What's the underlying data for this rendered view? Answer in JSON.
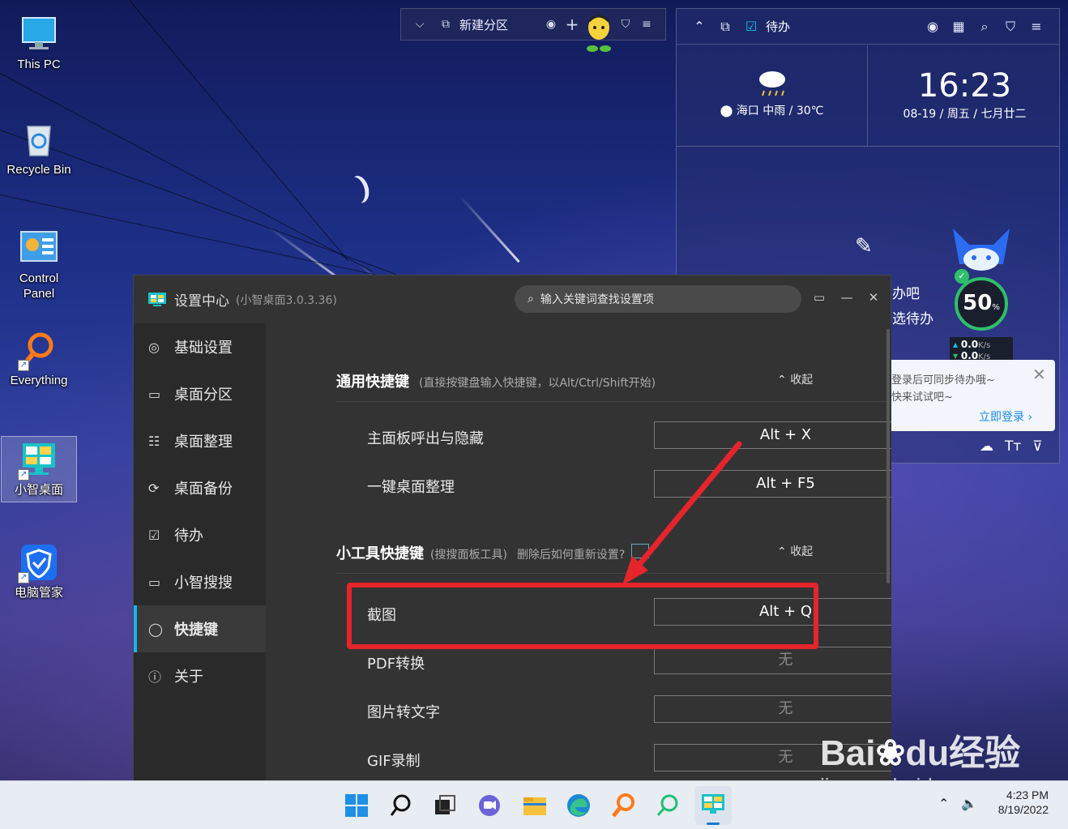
{
  "desktop": {
    "icons": [
      {
        "label": "This PC"
      },
      {
        "label": "Recycle Bin"
      },
      {
        "label": "Control Panel"
      },
      {
        "label": "Everything"
      },
      {
        "label": "小智桌面"
      },
      {
        "label": "电脑管家"
      }
    ]
  },
  "partition_bar": {
    "label": "新建分区",
    "icons": [
      "chevron-down-icon",
      "partition-icon",
      "user-icon",
      "plus-icon",
      "mascot-icon",
      "shirt-icon",
      "menu-icon"
    ]
  },
  "todo_widget": {
    "title": "待办",
    "weather": {
      "city": "海口",
      "condition": "中雨",
      "temp": "30℃",
      "icon": "rain-cloud-icon"
    },
    "clock": {
      "time": "16:23",
      "date": "08-19 / 周五 / 七月廿二"
    },
    "partial_text_1": "办吧",
    "partial_text_2": "选待办",
    "toolbar_icons": [
      "cloud-sync-icon",
      "font-size-icon",
      "filter-icon"
    ]
  },
  "speed_ball": {
    "percent": "50",
    "unit": "%",
    "upload": "0.0",
    "download": "0.0",
    "rate_unit": "K/s"
  },
  "login_popup": {
    "line1": "登录后可同步待办哦~",
    "line2": "快来试试吧~",
    "link": "立即登录"
  },
  "settings": {
    "title": "设置中心",
    "version": "(小智桌面3.0.3.36)",
    "search_placeholder": "输入关键词查找设置项",
    "nav": [
      {
        "label": "基础设置",
        "icon": "settings-circle-icon"
      },
      {
        "label": "桌面分区",
        "icon": "monitor-icon"
      },
      {
        "label": "桌面整理",
        "icon": "list-icon"
      },
      {
        "label": "桌面备份",
        "icon": "backup-icon"
      },
      {
        "label": "待办",
        "icon": "calendar-check-icon"
      },
      {
        "label": "小智搜搜",
        "icon": "search-box-icon"
      },
      {
        "label": "快捷键",
        "icon": "mouse-icon"
      },
      {
        "label": "关于",
        "icon": "info-icon"
      }
    ],
    "sections": [
      {
        "title": "通用快捷键",
        "subtitle": "(直接按键盘输入快捷键，以Alt/Ctrl/Shift开始)",
        "collapse": "收起",
        "rows": [
          {
            "label": "主面板呼出与隐藏",
            "key": "Alt + X"
          },
          {
            "label": "一键桌面整理",
            "key": "Alt + F5"
          }
        ]
      },
      {
        "title": "小工具快捷键",
        "subtitle": "(搜搜面板工具)",
        "hint": "删除后如何重新设置?",
        "collapse": "收起",
        "rows": [
          {
            "label": "截图",
            "key": "Alt + Q"
          },
          {
            "label": "PDF转换",
            "key": "无"
          },
          {
            "label": "图片转文字",
            "key": "无"
          },
          {
            "label": "GIF录制",
            "key": "无"
          }
        ]
      }
    ]
  },
  "watermark": {
    "brand_en": "Bai",
    "brand_du": "du",
    "brand_cn": "经验",
    "url": "jingyan.baidu.com"
  },
  "taskbar": {
    "time": "4:23 PM",
    "date": "8/19/2022",
    "apps": [
      "windows-start-icon",
      "search-icon",
      "task-view-icon",
      "chat-icon",
      "file-explorer-icon",
      "edge-icon",
      "everything-icon",
      "search-tool-icon",
      "xiaozhi-desktop-icon"
    ]
  },
  "colors": {
    "accent": "#18b4f0",
    "highlight": "#e5242b",
    "panel": "#333333"
  }
}
